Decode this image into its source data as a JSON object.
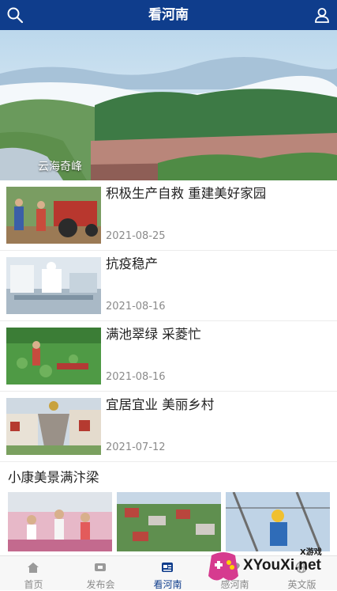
{
  "header": {
    "title": "看河南"
  },
  "hero": {
    "caption": "云海奇峰"
  },
  "news": [
    {
      "title": "积极生产自救 重建美好家园",
      "date": "2021-08-25"
    },
    {
      "title": "抗疫稳产",
      "date": "2021-08-16"
    },
    {
      "title": "满池翠绿 采菱忙",
      "date": "2021-08-16"
    },
    {
      "title": "宜居宜业 美丽乡村",
      "date": "2021-07-12"
    }
  ],
  "section": {
    "title": "小康美景满汴梁"
  },
  "nav": [
    {
      "label": "首页",
      "icon": "home-icon"
    },
    {
      "label": "发布会",
      "icon": "tv-icon"
    },
    {
      "label": "看河南",
      "icon": "newspaper-icon",
      "active": true
    },
    {
      "label": "感河南",
      "icon": "heart-icon"
    },
    {
      "label": "英文版",
      "icon": "globe-icon"
    }
  ],
  "watermark": {
    "text": "XYouXi.net",
    "small": "X游戏"
  },
  "colors": {
    "primary": "#0f3d8c",
    "muted": "#8a8a8a"
  }
}
